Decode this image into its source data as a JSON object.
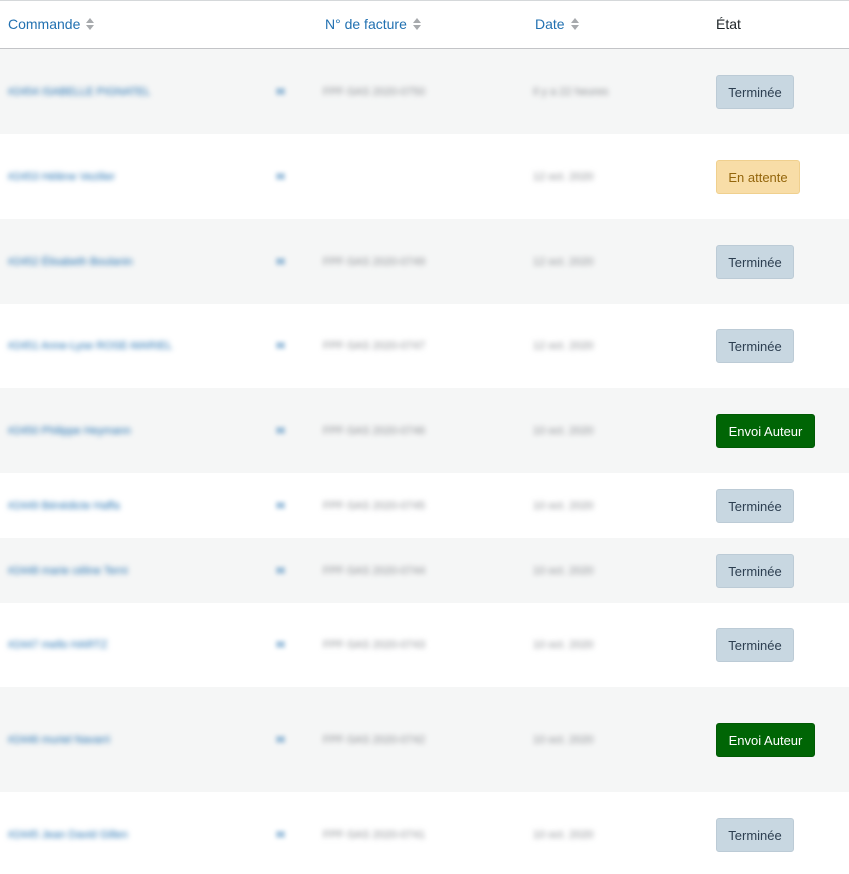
{
  "header": {
    "col_order": "Commande",
    "col_invoice": "N° de facture",
    "col_date": "Date",
    "col_state": "État",
    "sort_icon": "sort-arrows-icon"
  },
  "colors": {
    "link": "#2271b1",
    "status_done_bg": "#c8d7e1",
    "status_wait_bg": "#f8dda7",
    "status_author_bg": "#006505"
  },
  "rows": [
    {
      "order": "#2454 ISABELLE PIGNATEL",
      "invoice": "FPF-SAS 2020-0750",
      "date": "Il y a 22 heures",
      "status": "Terminée",
      "status_type": "done"
    },
    {
      "order": "#2453 Hélène Vezilier",
      "invoice": "",
      "date": "12 oct. 2020",
      "status": "En attente",
      "status_type": "wait"
    },
    {
      "order": "#2452 Élisabeth Boulanin",
      "invoice": "FPF-SAS 2020-0749",
      "date": "12 oct. 2020",
      "status": "Terminée",
      "status_type": "done"
    },
    {
      "order": "#2451 Anne-Lyse ROSE-MARIEL",
      "invoice": "FPF-SAS 2020-0747",
      "date": "12 oct. 2020",
      "status": "Terminée",
      "status_type": "done"
    },
    {
      "order": "#2450 Philippe Heymann",
      "invoice": "FPF-SAS 2020-0746",
      "date": "10 oct. 2020",
      "status": "Envoi Auteur",
      "status_type": "author"
    },
    {
      "order": "#2449 Bénédicte Haffa",
      "invoice": "FPF-SAS 2020-0745",
      "date": "10 oct. 2020",
      "status": "Terminée",
      "status_type": "done"
    },
    {
      "order": "#2448 marie céline Terni",
      "invoice": "FPF-SAS 2020-0744",
      "date": "10 oct. 2020",
      "status": "Terminée",
      "status_type": "done"
    },
    {
      "order": "#2447 mello HARTZ",
      "invoice": "FPF-SAS 2020-0743",
      "date": "10 oct. 2020",
      "status": "Terminée",
      "status_type": "done"
    },
    {
      "order": "#2446 muriel Navarri",
      "invoice": "FPF-SAS 2020-0742",
      "date": "10 oct. 2020",
      "status": "Envoi Auteur",
      "status_type": "author"
    },
    {
      "order": "#2445 Jean David Gillen",
      "invoice": "FPF-SAS 2020-0741",
      "date": "10 oct. 2020",
      "status": "Terminée",
      "status_type": "done"
    }
  ]
}
